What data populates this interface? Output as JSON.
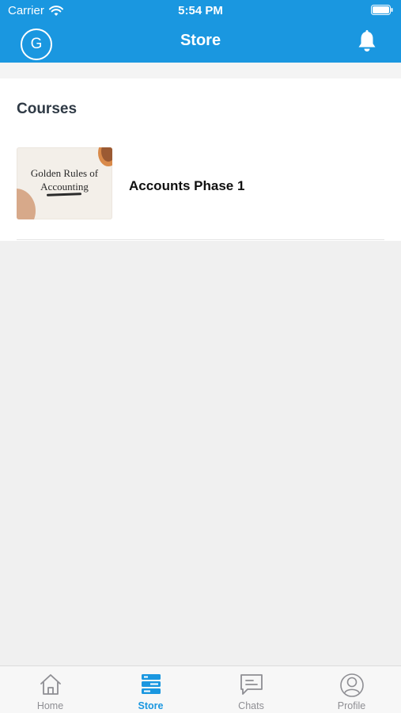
{
  "status_bar": {
    "carrier": "Carrier",
    "time": "5:54 PM"
  },
  "nav": {
    "avatar_initial": "G",
    "title": "Store",
    "accent_color": "#1a97e0"
  },
  "courses_section": {
    "heading": "Courses",
    "items": [
      {
        "title": "Accounts Phase 1",
        "thumbnail_text_line1": "Golden Rules of",
        "thumbnail_text_line2": "Accounting"
      }
    ]
  },
  "tabbar": {
    "tabs": [
      {
        "label": "Home",
        "icon": "home-icon",
        "active": false
      },
      {
        "label": "Store",
        "icon": "store-icon",
        "active": true
      },
      {
        "label": "Chats",
        "icon": "chat-icon",
        "active": false
      },
      {
        "label": "Profile",
        "icon": "profile-icon",
        "active": false
      }
    ]
  }
}
